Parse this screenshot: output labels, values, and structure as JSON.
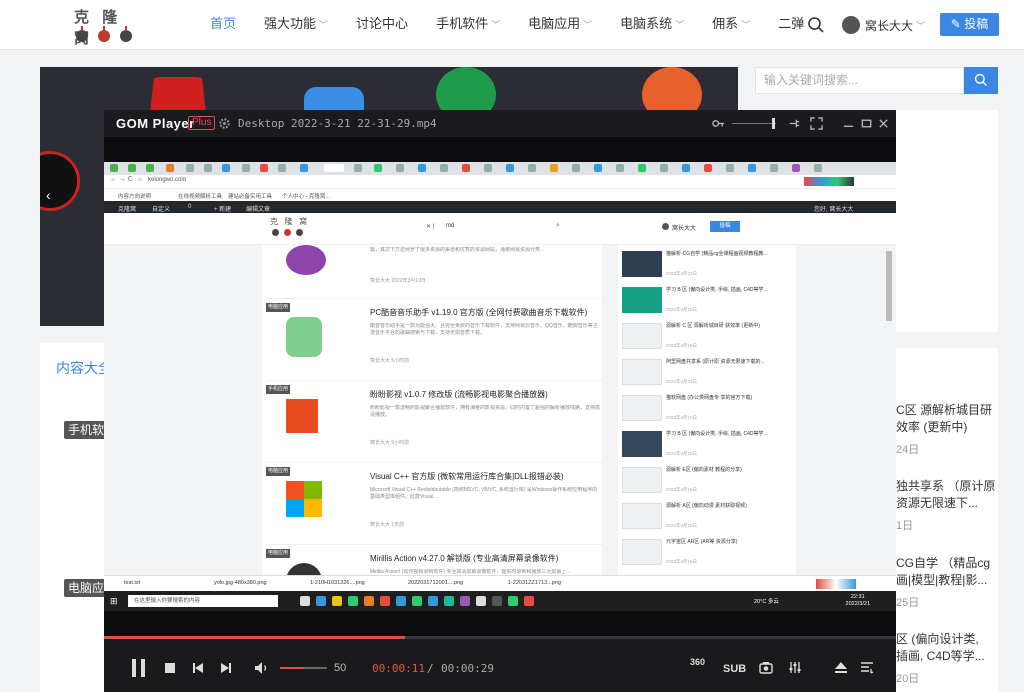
{
  "site": {
    "logo_text": "克 隆 窝",
    "nav": [
      {
        "label": "首页"
      },
      {
        "label": "强大功能"
      },
      {
        "label": "讨论中心"
      },
      {
        "label": "手机软件"
      },
      {
        "label": "电脑应用"
      },
      {
        "label": "电脑系统"
      },
      {
        "label": "佣系"
      },
      {
        "label": "二弹"
      }
    ],
    "username": "窝长大大",
    "post_button": "投稿",
    "search_placeholder": "输入关键词搜索...",
    "content_title": "内容大全",
    "tags": [
      "手机软件",
      "电脑应用"
    ],
    "side_items": [
      {
        "line1": "C区 源解析城目研",
        "line2": "效率 (更新中)",
        "date": "24日"
      },
      {
        "line1": "独共享系 （原计原",
        "line2": "资源无限速下...",
        "date": "1日"
      },
      {
        "line1": "CG自学 （精品cg",
        "line2": "画|模型|教程|影...",
        "date": "25日"
      },
      {
        "line1": "区 (偏向设计类,",
        "line2": "插画, C4D等学...",
        "date": "20日"
      }
    ]
  },
  "player": {
    "app_name": "GOM Player",
    "plus_label": "Plus",
    "file_title": "Desktop 2022-3-21 22-31-29.mp4",
    "progress": 0.38,
    "volume_fraction": 0.5,
    "volume": "50",
    "time_current": "00:00:11",
    "time_separator": "/",
    "time_total": "00:00:29",
    "label_360": "360",
    "sub_label": "SUB"
  },
  "video": {
    "url": "kelongwo.com",
    "bookmarks": [
      "内容方向说明",
      "在线视频解析工具",
      "建站必备实用工具",
      "个人中心 - 克隆窝..."
    ],
    "admin_bar": [
      "克隆窝",
      "自定义",
      "0",
      "+ 新建",
      "编辑文章"
    ],
    "admin_greeting": "您好, 窝长大大",
    "logo_text": "克 隆 窝",
    "search_text": "md",
    "username": "窝长大大",
    "post_button": "投稿",
    "items": [
      {
        "tag": "",
        "title": "",
        "desc": "篇，其次下方还网罗了很多资源的渠道和优秀的资源网站，海量网易资源分类...",
        "meta": "窝长大大   2022年3月19日"
      },
      {
        "tag": "电脑应用",
        "title": "PC酷音音乐助手 v1.19.0 官方版 (全网付费歌曲音乐下载软件)",
        "desc": "酷音音乐助手是一款功能强大、且完全免费的音乐下载软件，支持网易云音乐、QQ音乐、酷狗音乐等主流音乐平台的歌曲搜索与下载，支持无损音质下载。",
        "meta": "窝长大大   5小时前"
      },
      {
        "tag": "手机应用",
        "title": "盼盼影视 v1.0.7 修改版 (流畅影视电影聚合播放器)",
        "desc": "盼盼影视一款流畅的影视聚合播放软件，拥有海量的影视资源，同时内置了超强的解析播放线路，支持高清播放。",
        "meta": "窝长大大   5小时前"
      },
      {
        "tag": "电脑应用",
        "title": "Visual C++ 官方版 (微软常用运行库合集|DLL报错必装)",
        "desc": "Microsoft Visual C++ Redistributable (简称MSVC, VB/VC, 系统运行库) 是Windows操作系统应用程序的基础类型库组件。此款Visual...",
        "meta": "窝长大大   1天前"
      },
      {
        "tag": "电脑应用",
        "title": "Mirillis Action v4.27.0 解锁版 (专业高清屏幕录像软件)",
        "desc": "Mirillis Action! (动作视频录制软件) 专业高清屏幕录像软件，能实时录制和播放三大屏幕上...",
        "meta": "窝长大大   1天前"
      }
    ],
    "sidebar": [
      {
        "text": "猫解析-CG自学 (精品cg全课程画视频教程教...",
        "date": "2022年3月22日"
      },
      {
        "text": "学习 B 区 (偏向设计类, 手绘, 插画, C4D等学...",
        "date": "2022年3月16日"
      },
      {
        "text": "源解析 C 区 源解析城目研 获效率 (更新中)",
        "date": "2022年3月18日"
      },
      {
        "text": "阿里网盘共享系 (原计原 资源无限速下载的...",
        "date": "2022年3月23日"
      },
      {
        "text": "猫软网盘 (办公类网盘专 享的官方下载)",
        "date": "2022年3月10日"
      },
      {
        "text": "学习 B 区 (偏向设计类, 手绘, 插画, C4D等学...",
        "date": "2022年3月16日"
      },
      {
        "text": "源解析 E区 (偏向素材 教程的分享)",
        "date": "2022年3月16日"
      },
      {
        "text": "源解析 A区 (偏向动漫 素材获取视频)",
        "date": "2022年3月16日"
      },
      {
        "text": "元宇宙区 AR区 (AR等 资源分享)",
        "date": "2022年3月16日"
      }
    ],
    "downloads": [
      "test.txt",
      "yolo.jpg-480x380.png",
      "1-210H1031326....png",
      "2022031712001....png",
      "1-22031ZZ1713...png"
    ],
    "taskbar_search": "在这里输入你要搜索的内容",
    "clock_time": "22:31",
    "clock_date": "2022/3/21",
    "temp": "20°C 多云"
  },
  "colors": {
    "accent": "#3a86e0",
    "player_red": "#e0503f"
  }
}
